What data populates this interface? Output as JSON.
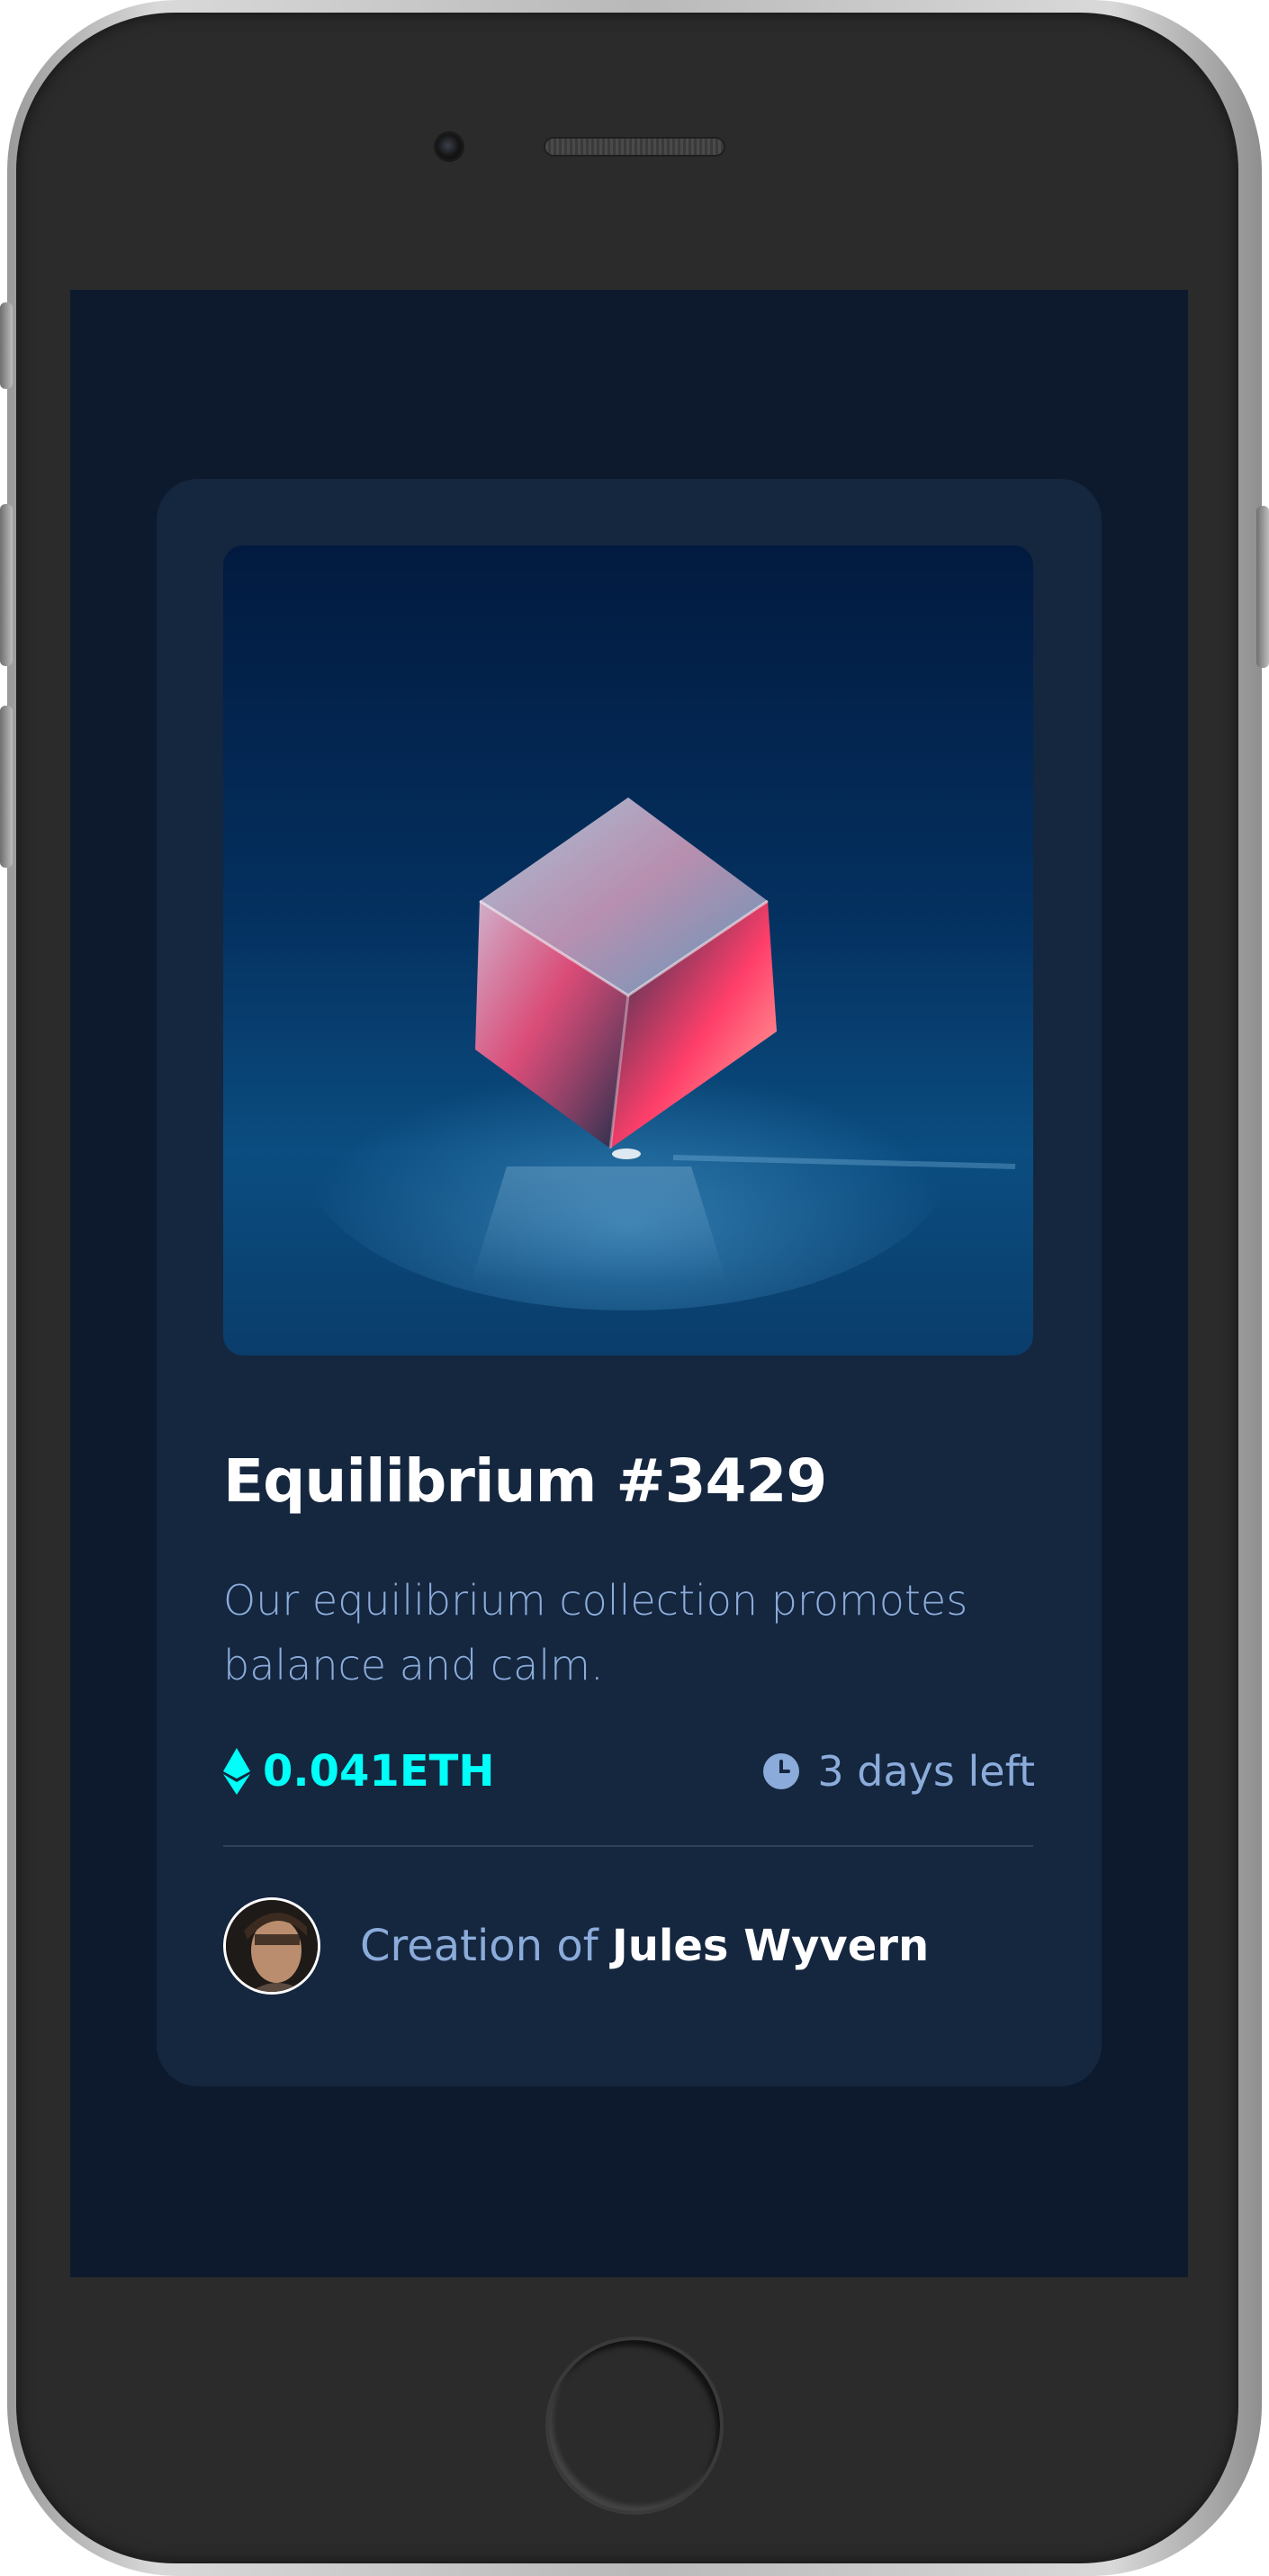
{
  "card": {
    "title": "Equilibrium #3429",
    "description": "Our equilibrium collection promotes balance and calm.",
    "price": "0.041ETH",
    "time_left": "3 days left",
    "creator_prefix": "Creation of",
    "creator_name": "Jules Wyvern"
  },
  "icons": {
    "price": "ethereum-icon",
    "time": "clock-icon",
    "image": "cube-image",
    "avatar": "avatar"
  },
  "colors": {
    "screen_bg": "#0d1a2d",
    "card_bg": "#15263f",
    "accent_cyan": "#00fff8",
    "soft_blue": "#8bacda",
    "white": "#ffffff",
    "divider": "#2e405a"
  }
}
